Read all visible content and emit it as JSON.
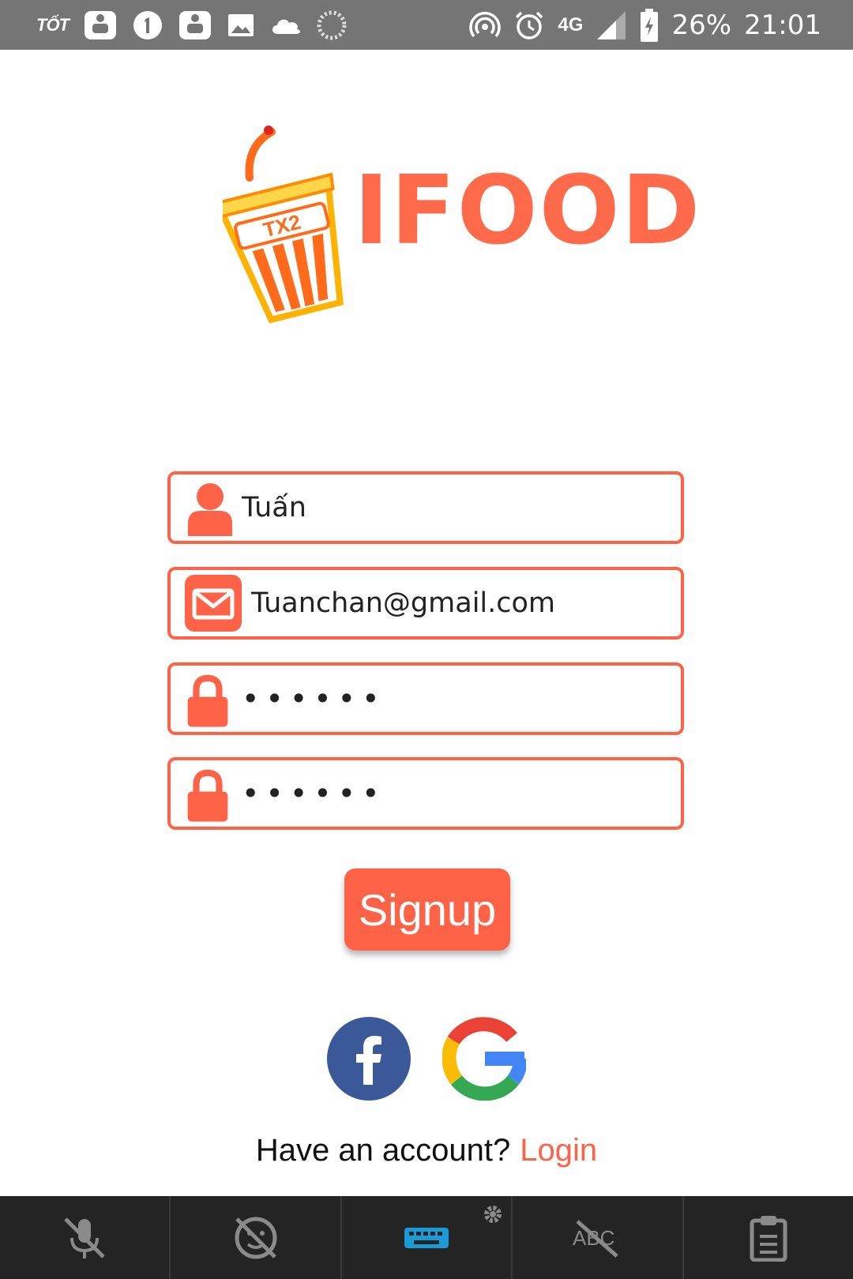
{
  "status_bar": {
    "carrier": "TỐT",
    "network": "4G",
    "battery": "26%",
    "time": "21:01",
    "left_icons": [
      "piggy-bank-icon",
      "notification-one-icon",
      "piggy-bank-icon",
      "image-icon",
      "cloud-icon",
      "loading-icon"
    ],
    "right_icons": [
      "hotspot-icon",
      "alarm-icon",
      "signal-icon",
      "battery-charging-icon"
    ]
  },
  "logo": {
    "badge": "TX2",
    "text": "IFOOD"
  },
  "form": {
    "name_value": "Tuấn",
    "email_value": "Tuanchan@gmail.com",
    "password_value": "••••••",
    "confirm_password_value": "••••••"
  },
  "signup_label": "Signup",
  "social": [
    "facebook-icon",
    "google-icon"
  ],
  "footer": {
    "prompt": "Have an account?",
    "login_label": "Login"
  },
  "keyboard_bar": [
    "mic-off-icon",
    "emoji-off-icon",
    "keyboard-icon",
    "spellcheck-off-icon",
    "clipboard-icon"
  ],
  "colors": {
    "accent": "#ff6347",
    "status_bar": "#757575",
    "facebook": "#3b5998",
    "keyboard_bar": "#242424",
    "keyboard_active": "#1a9ad6"
  }
}
